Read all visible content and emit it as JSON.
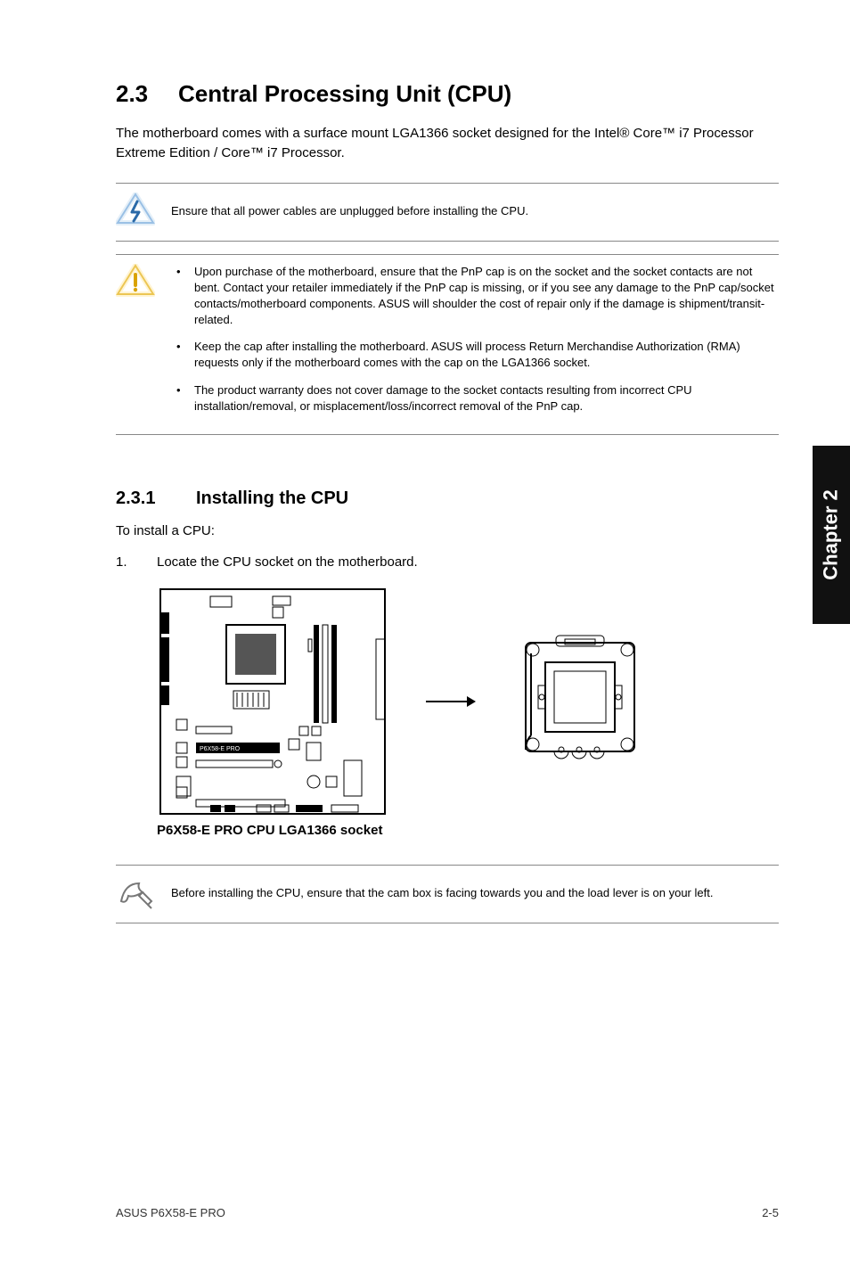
{
  "section": {
    "number": "2.3",
    "title": "Central Processing Unit (CPU)"
  },
  "intro": "The motherboard comes with a surface mount LGA1366 socket designed for the Intel® Core™ i7 Processor Extreme Edition / Core™ i7 Processor.",
  "warning_single": "Ensure that all power cables are unplugged before installing the CPU.",
  "caution_items": [
    "Upon purchase of the motherboard, ensure that the PnP cap is on the socket and the socket contacts are not bent. Contact your retailer immediately if the PnP cap is missing, or if you see any damage to the PnP cap/socket contacts/motherboard components. ASUS will shoulder the cost of repair only if the damage is shipment/transit-related.",
    "Keep the cap after installing the motherboard. ASUS will process Return Merchandise Authorization (RMA) requests only if the motherboard comes with the cap on the LGA1366 socket.",
    "The product warranty does not cover damage to the socket contacts resulting from incorrect CPU installation/removal, or misplacement/loss/incorrect removal of the PnP cap."
  ],
  "subsection": {
    "number": "2.3.1",
    "title": "Installing the CPU"
  },
  "to_install": "To install a CPU:",
  "step1_num": "1.",
  "step1_text": "Locate the CPU socket on the motherboard.",
  "diagram_caption": "P6X58-E PRO CPU LGA1366 socket",
  "board_label": "P6X58-E PRO",
  "tip_text": "Before installing the CPU, ensure that the cam box is facing towards you and the load lever is on your left.",
  "sidebar": "Chapter 2",
  "footer_left": "ASUS P6X58-E PRO",
  "footer_right": "2-5"
}
